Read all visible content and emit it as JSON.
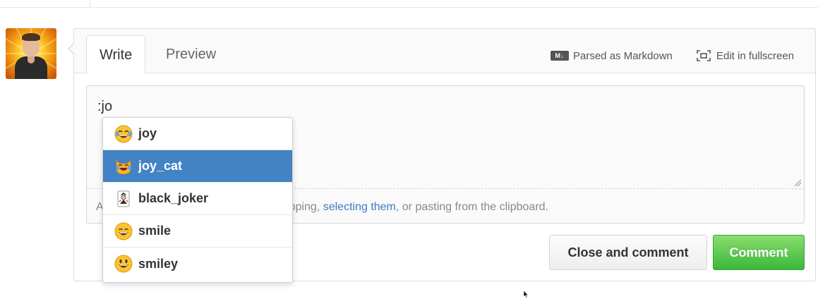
{
  "tabs": {
    "write": "Write",
    "preview": "Preview"
  },
  "header": {
    "markdown_badge": "M↓",
    "markdown_hint": "Parsed as Markdown",
    "fullscreen_hint": "Edit in fullscreen"
  },
  "editor": {
    "typed_text": ":jo",
    "drop_hint_prefix": "A",
    "drop_hint_middle": "pping, ",
    "drop_hint_link": "selecting them",
    "drop_hint_suffix": ", or pasting from the clipboard."
  },
  "suggestions": [
    {
      "label": "joy",
      "icon": "joy-emoji-icon",
      "active": false
    },
    {
      "label": "joy_cat",
      "icon": "joy-cat-emoji-icon",
      "active": true
    },
    {
      "label": "black_joker",
      "icon": "black-joker-emoji-icon",
      "active": false
    },
    {
      "label": "smile",
      "icon": "smile-emoji-icon",
      "active": false
    },
    {
      "label": "smiley",
      "icon": "smiley-emoji-icon",
      "active": false
    }
  ],
  "buttons": {
    "close_and_comment": "Close and comment",
    "comment": "Comment"
  },
  "colors": {
    "accent_blue": "#4183c4",
    "link_blue": "#4078c0",
    "comment_green": "#3ab83a"
  }
}
